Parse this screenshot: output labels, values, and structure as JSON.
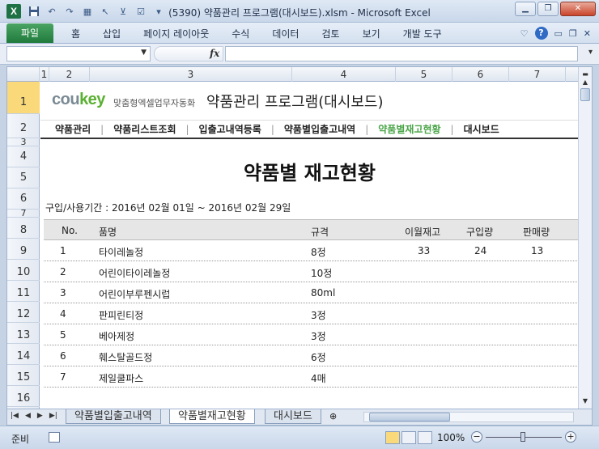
{
  "window": {
    "title": "(5390) 약품관리 프로그램(대시보드).xlsm  -  Microsoft Excel",
    "app_icon": "X"
  },
  "ribbon": {
    "file_tab": "파일",
    "tabs": [
      "홈",
      "삽입",
      "페이지 레이아웃",
      "수식",
      "데이터",
      "검토",
      "보기",
      "개발 도구"
    ]
  },
  "formula_bar": {
    "fx": "fx",
    "name": "",
    "value": ""
  },
  "columns": [
    "1",
    "2",
    "3",
    "4",
    "5",
    "6",
    "7"
  ],
  "rows": [
    "1",
    "2",
    "3",
    "4",
    "5",
    "6",
    "7",
    "8",
    "9",
    "10",
    "11",
    "12",
    "13",
    "14",
    "15",
    "16"
  ],
  "sheet": {
    "logo_main": "cou",
    "logo_accent": "key",
    "logo_sub": "맞춤형엑셀업무자동화",
    "program_title": "약품관리 프로그램(대시보드)",
    "menu": [
      "약품관리",
      "약품리스트조회",
      "입출고내역등록",
      "약품별입출고내역",
      "약품별재고현황",
      "대시보드"
    ],
    "heading": "약품별 재고현황",
    "period": "구입/사용기간 : 2016년 02월 01일 ~ 2016년 02월 29일",
    "table_headers": [
      "No.",
      "품명",
      "규격",
      "이월재고",
      "구입량",
      "판매량"
    ],
    "table_rows": [
      [
        "1",
        "타이레놀정",
        "8정",
        "33",
        "24",
        "13"
      ],
      [
        "2",
        "어린이타이레놀정",
        "10정",
        "",
        "",
        ""
      ],
      [
        "3",
        "어린이부루펜시럽",
        "80ml",
        "",
        "",
        ""
      ],
      [
        "4",
        "판피린티정",
        "3정",
        "",
        "",
        ""
      ],
      [
        "5",
        "베아제정",
        "3정",
        "",
        "",
        ""
      ],
      [
        "6",
        "훼스탈골드정",
        "6정",
        "",
        "",
        ""
      ],
      [
        "7",
        "제일쿨파스",
        "4매",
        "",
        "",
        ""
      ]
    ]
  },
  "sheet_tabs": [
    "약품별입출고내역",
    "약품별재고현황",
    "대시보드"
  ],
  "status": {
    "ready": "준비",
    "zoom": "100%"
  },
  "colors": {
    "accent": "#4aa548",
    "file_tab": "#1f7a3c",
    "selected_row_header": "#f9d97a"
  }
}
